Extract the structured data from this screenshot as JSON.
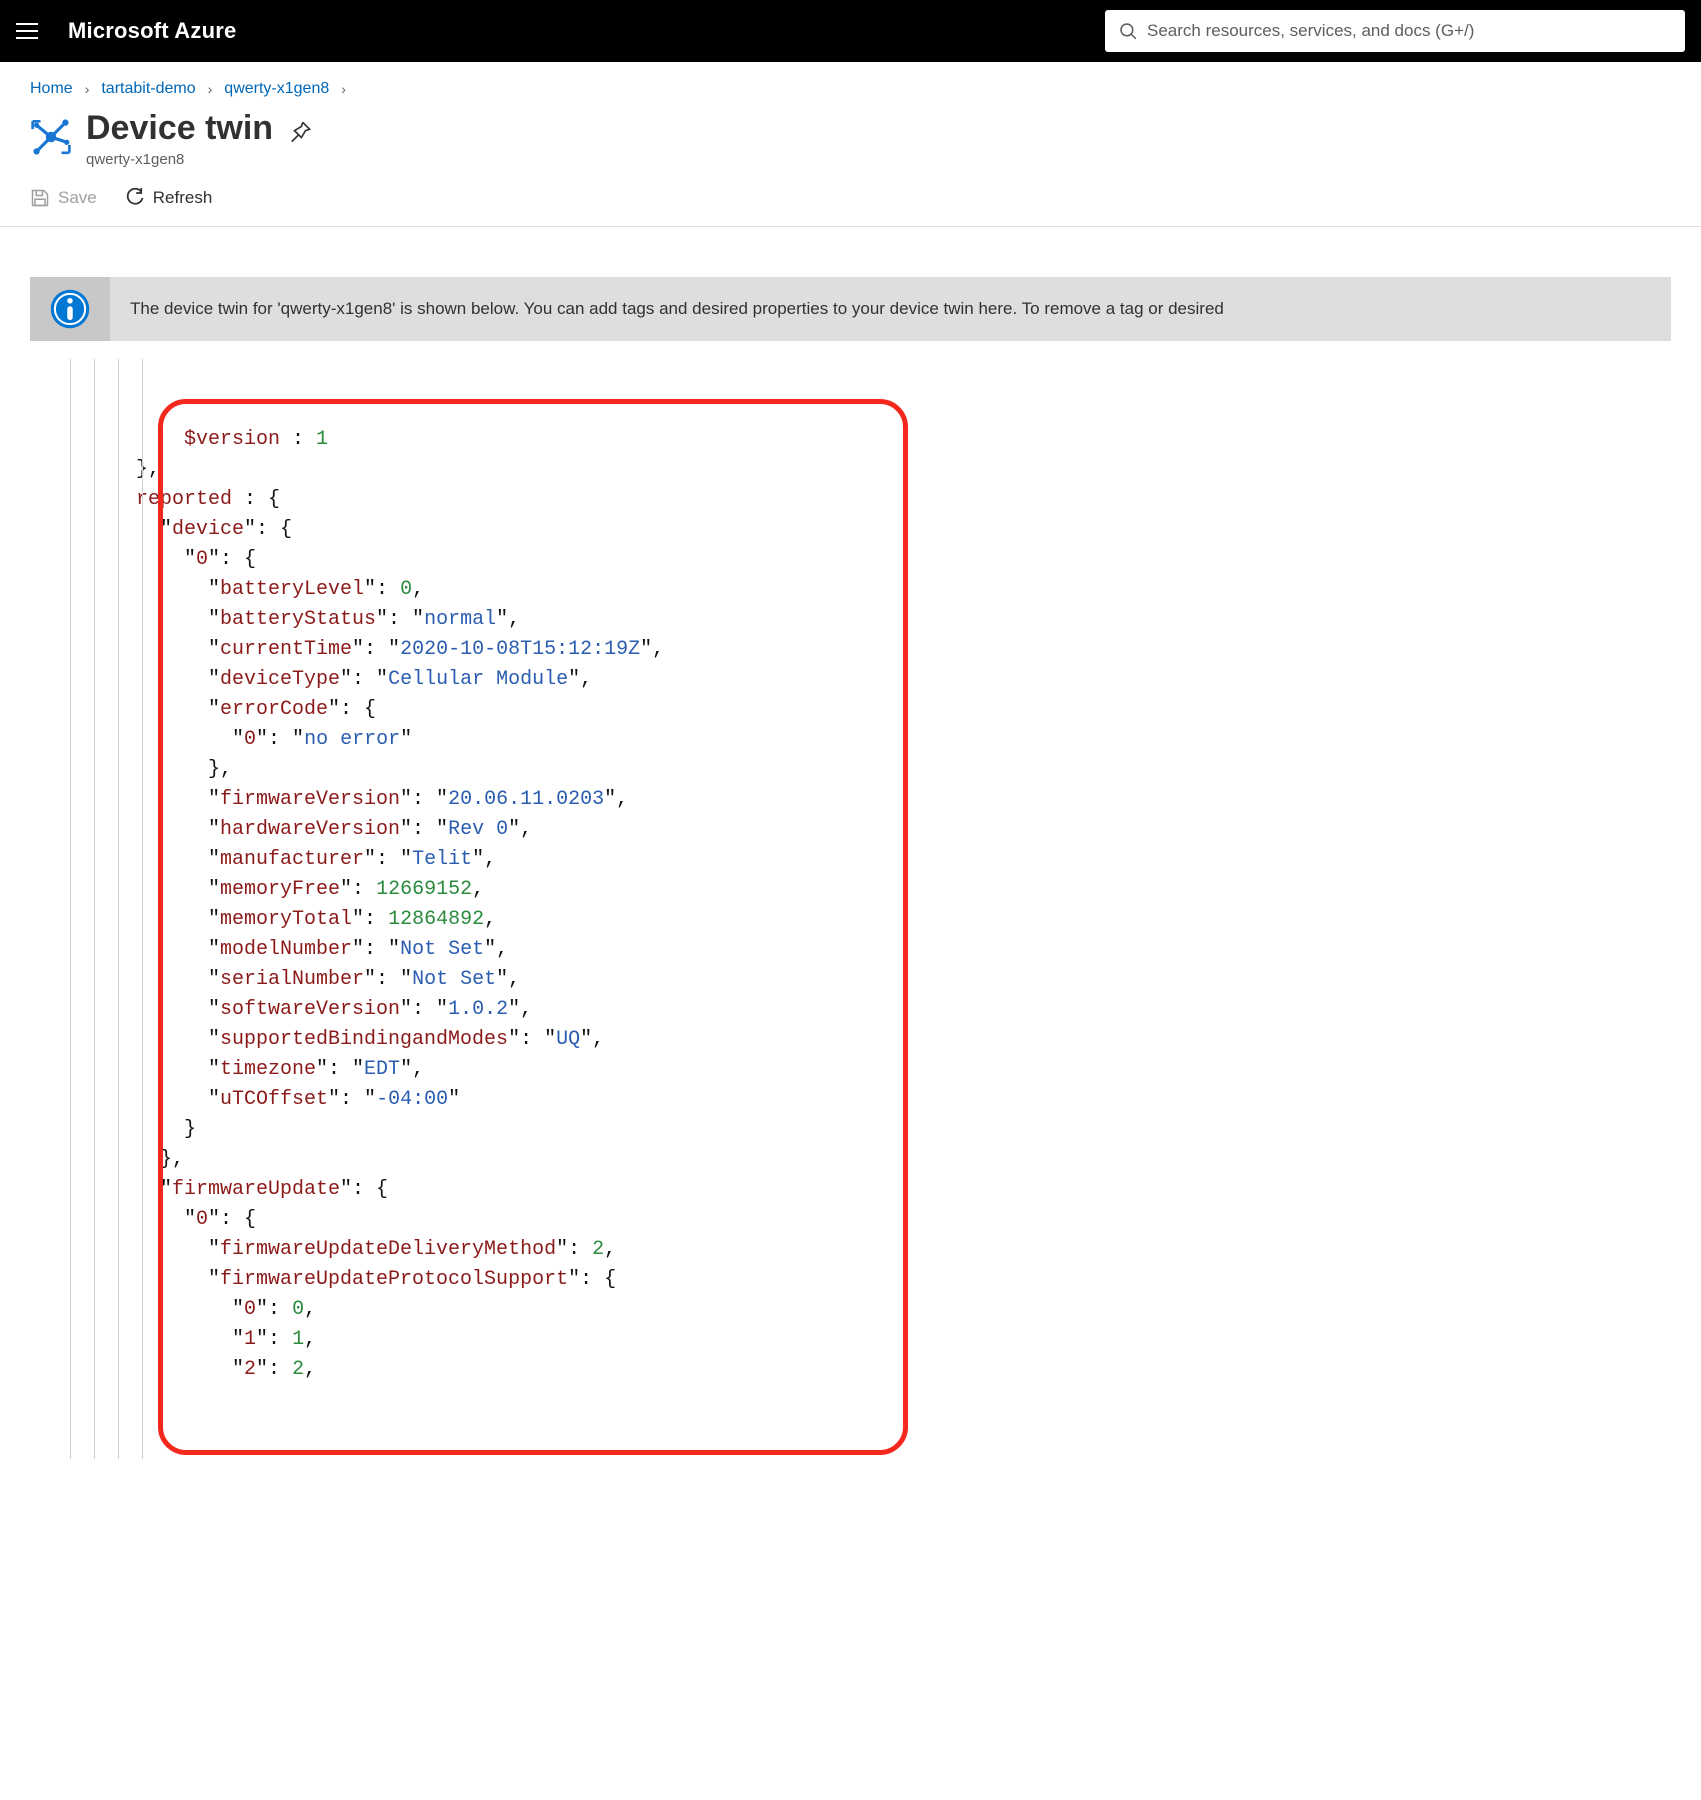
{
  "header": {
    "brand": "Microsoft Azure",
    "search_placeholder": "Search resources, services, and docs (G+/)"
  },
  "breadcrumbs": {
    "home": "Home",
    "l1": "tartabit-demo",
    "l2": "qwerty-x1gen8"
  },
  "page": {
    "title": "Device twin",
    "subtitle": "qwerty-x1gen8"
  },
  "commands": {
    "save": "Save",
    "refresh": "Refresh"
  },
  "notice": {
    "text": "The device twin for 'qwerty-x1gen8' is shown below. You can add tags and desired properties to your device twin here. To remove a tag or desired"
  },
  "twin": {
    "version_fragment": "1",
    "reported_label": "reported",
    "device_label": "device",
    "zero": "0",
    "batteryLevel_k": "batteryLevel",
    "batteryLevel_v": 0,
    "batteryStatus_k": "batteryStatus",
    "batteryStatus_v": "normal",
    "currentTime_k": "currentTime",
    "currentTime_v": "2020-10-08T15:12:19Z",
    "deviceType_k": "deviceType",
    "deviceType_v": "Cellular Module",
    "errorCode_k": "errorCode",
    "errorCode_0_k": "0",
    "errorCode_0_v": "no error",
    "firmwareVersion_k": "firmwareVersion",
    "firmwareVersion_v": "20.06.11.0203",
    "hardwareVersion_k": "hardwareVersion",
    "hardwareVersion_v": "Rev 0",
    "manufacturer_k": "manufacturer",
    "manufacturer_v": "Telit",
    "memoryFree_k": "memoryFree",
    "memoryFree_v": 12669152,
    "memoryTotal_k": "memoryTotal",
    "memoryTotal_v": 12864892,
    "modelNumber_k": "modelNumber",
    "modelNumber_v": "Not Set",
    "serialNumber_k": "serialNumber",
    "serialNumber_v": "Not Set",
    "softwareVersion_k": "softwareVersion",
    "softwareVersion_v": "1.0.2",
    "supportedBindingandModes_k": "supportedBindingandModes",
    "supportedBindingandModes_v": "UQ",
    "timezone_k": "timezone",
    "timezone_v": "EDT",
    "uTCOffset_k": "uTCOffset",
    "uTCOffset_v": "-04:00",
    "firmwareUpdate_label": "firmwareUpdate",
    "fu_delivery_k": "firmwareUpdateDeliveryMethod",
    "fu_delivery_v": 2,
    "fu_protocol_k": "firmwareUpdateProtocolSupport",
    "fu_p0_k": "0",
    "fu_p0_v": 0,
    "fu_p1_k": "1",
    "fu_p1_v": 1,
    "fu_p2_k": "2",
    "fu_p2_v": 2
  }
}
